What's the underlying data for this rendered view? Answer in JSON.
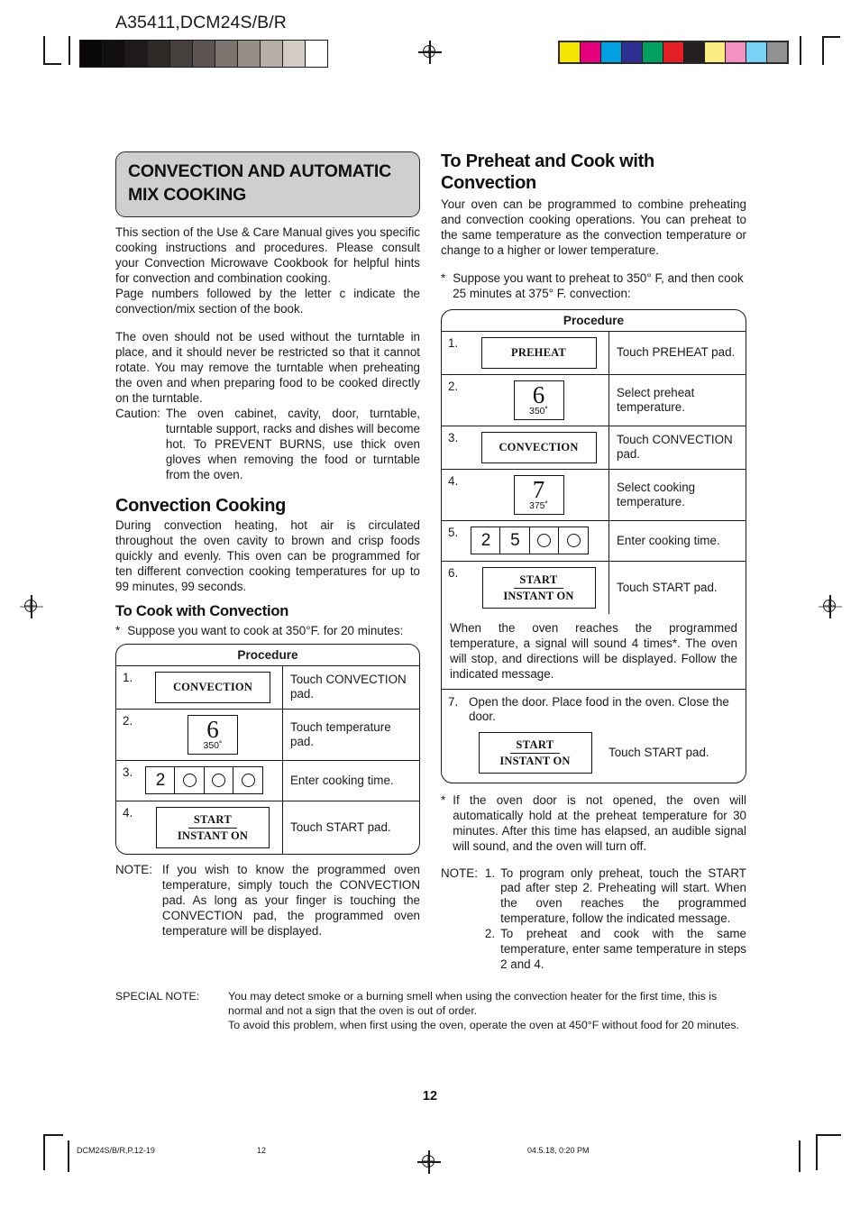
{
  "header": {
    "doc_code": "A35411,DCM24S/B/R",
    "grayscale_swatches": [
      "#0a0708",
      "#120f10",
      "#1d1a19",
      "#2e2a28",
      "#45403d",
      "#5b5450",
      "#7a736e",
      "#968e89",
      "#b6afa9",
      "#d2cbc6",
      "#ffffff"
    ],
    "color_swatches": [
      "#f5e400",
      "#e6007e",
      "#00a0e2",
      "#2e3192",
      "#00a160",
      "#e31e24",
      "#231f20",
      "#faec80",
      "#f391c0",
      "#79d2f5",
      "#929292"
    ]
  },
  "left_column": {
    "title": "CONVECTION AND AUTOMATIC MIX COOKING",
    "intro_p1": "This section of the Use & Care Manual gives you specific cooking instructions and procedures. Please consult your Convection Microwave Cookbook for helpful hints for convection and combination cooking.",
    "intro_p2": "Page numbers followed by the letter c indicate the convection/mix section of the book.",
    "intro_p3": "The oven should not be used without the turntable in place, and it should never be restricted so that it cannot rotate. You may remove the turntable when preheating the oven and when preparing food to be cooked directly on the turntable.",
    "caution_label": "Caution:",
    "caution_text": "The oven cabinet, cavity, door, turntable, turntable support, racks and dishes will become hot. To PREVENT BURNS, use thick oven gloves when removing the food or turntable from the oven.",
    "heading_convection_cooking": "Convection Cooking",
    "convection_cooking_text": "During convection heating, hot air is circulated throughout the oven cavity to brown and crisp foods quickly and evenly. This oven can be programmed for ten different convection cooking temperatures for up to 99 minutes, 99 seconds.",
    "heading_to_cook": "To Cook with Convection",
    "suppose_marker": "*",
    "suppose_text": "Suppose you want to cook at 350°F. for 20 minutes:",
    "procedure_header": "Procedure",
    "steps": [
      {
        "num": "1.",
        "pad_type": "word",
        "pad_label": "CONVECTION",
        "desc": "Touch CONVECTION pad."
      },
      {
        "num": "2.",
        "pad_type": "temp",
        "pad_big": "6",
        "pad_small": "350˚",
        "desc": "Touch temperature pad."
      },
      {
        "num": "3.",
        "pad_type": "keys",
        "keys": [
          "2",
          "circle",
          "circle",
          "circle"
        ],
        "desc": "Enter cooking time."
      },
      {
        "num": "4.",
        "pad_type": "start",
        "pad_line1": "START",
        "pad_line2": "INSTANT ON",
        "desc": "Touch START pad."
      }
    ],
    "note_label": "NOTE:",
    "note_text": "If you wish to know the programmed oven temperature, simply touch the CONVECTION pad. As long as your finger is touching the CONVECTION pad, the programmed oven temperature will be displayed."
  },
  "right_column": {
    "heading": "To Preheat and Cook with Convection",
    "intro": "Your oven can be programmed to combine preheating and convection cooking operations. You can preheat to the same temperature as the convection temperature or change to a higher or lower temperature.",
    "suppose_marker": "*",
    "suppose_text": "Suppose you want to preheat to 350° F, and then cook 25 minutes at 375° F. convection:",
    "procedure_header": "Procedure",
    "steps": [
      {
        "num": "1.",
        "pad_type": "word",
        "pad_label": "PREHEAT",
        "desc": "Touch PREHEAT pad."
      },
      {
        "num": "2.",
        "pad_type": "temp",
        "pad_big": "6",
        "pad_small": "350˚",
        "desc": "Select preheat temperature."
      },
      {
        "num": "3.",
        "pad_type": "word",
        "pad_label": "CONVECTION",
        "desc": "Touch CONVECTION  pad."
      },
      {
        "num": "4.",
        "pad_type": "temp",
        "pad_big": "7",
        "pad_small": "375˚",
        "desc": "Select cooking temperature."
      },
      {
        "num": "5.",
        "pad_type": "keys",
        "keys": [
          "2",
          "5",
          "circle",
          "circle"
        ],
        "desc": "Enter cooking time."
      },
      {
        "num": "6.",
        "pad_type": "start",
        "pad_line1": "START",
        "pad_line2": "INSTANT ON",
        "desc": "Touch START pad."
      }
    ],
    "interstitial": "When the oven reaches the programmed temperature, a signal will sound 4 times*. The oven will stop, and directions will be displayed. Follow the indicated message.",
    "step7_num": "7.",
    "step7_text": "Open the door. Place food in the oven. Close the door.",
    "step7_pad_line1": "START",
    "step7_pad_line2": "INSTANT ON",
    "step7_desc": "Touch START pad.",
    "footnote_marker": "*",
    "footnote_text": "If the oven door is not opened, the oven will automatically hold at the preheat temperature for 30 minutes. After this time has elapsed, an audible signal will sound, and the oven will turn off.",
    "note_label": "NOTE:",
    "note_items": [
      {
        "num": "1.",
        "text": "To program only preheat, touch the START pad after step 2. Preheating will start. When the oven reaches the programmed temperature, follow the indicated message."
      },
      {
        "num": "2.",
        "text": "To preheat and cook with the same temperature, enter same temperature in steps 2 and 4."
      }
    ]
  },
  "bottom": {
    "special_note_label": "SPECIAL NOTE:",
    "special_note_p1": "You may detect smoke or a burning smell when using the convection heater for the first time, this is normal and not a sign that the oven is out of order.",
    "special_note_p2": "To avoid this problem, when first using the oven, operate the oven at 450°F without food for 20 minutes.",
    "page_number": "12",
    "footer_left": "DCM24S/B/R,P.12-19",
    "footer_mid": "12",
    "footer_right": "04.5.18, 0:20 PM"
  }
}
